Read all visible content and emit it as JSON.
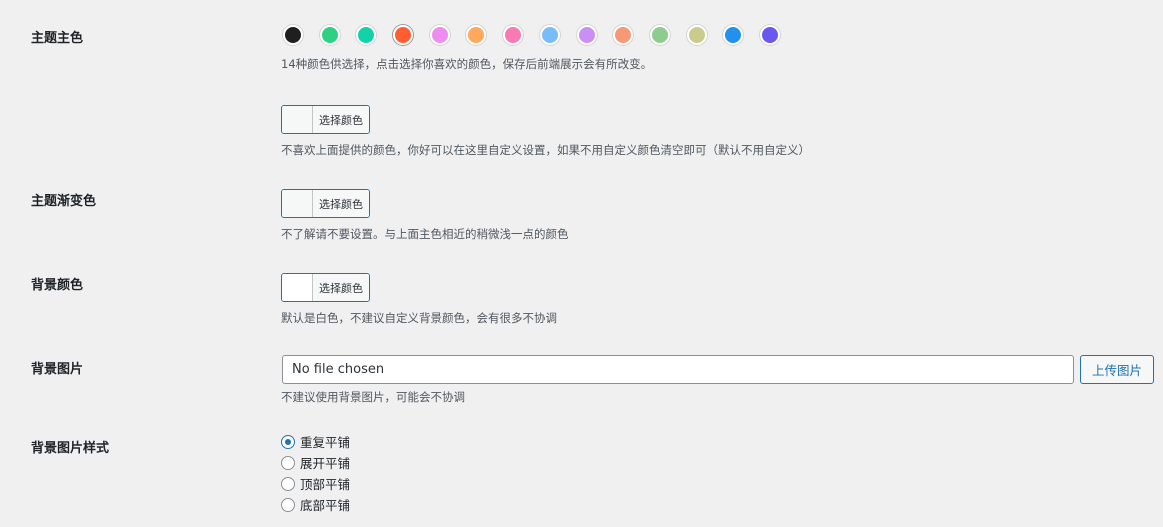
{
  "theme_color": {
    "label": "主题主色",
    "swatches": [
      {
        "name": "black",
        "color": "#1f1f1f"
      },
      {
        "name": "green",
        "color": "#2fd083"
      },
      {
        "name": "teal",
        "color": "#12d2aa"
      },
      {
        "name": "orange-red",
        "color": "#ff5e32",
        "selected": true
      },
      {
        "name": "violet",
        "color": "#ee8cf0"
      },
      {
        "name": "light-orange",
        "color": "#ffa85e"
      },
      {
        "name": "pink",
        "color": "#f97ab2"
      },
      {
        "name": "sky-blue",
        "color": "#78bdfa"
      },
      {
        "name": "lavender",
        "color": "#c98ff5"
      },
      {
        "name": "salmon",
        "color": "#f79876"
      },
      {
        "name": "sage-green",
        "color": "#8dcb8e"
      },
      {
        "name": "khaki",
        "color": "#cccb8e"
      },
      {
        "name": "blue",
        "color": "#2290ec"
      },
      {
        "name": "indigo",
        "color": "#6a57ee"
      }
    ],
    "desc": "14种颜色供选择，点击选择你喜欢的颜色，保存后前端展示会有所改变。"
  },
  "custom_color": {
    "button": "选择颜色",
    "desc": "不喜欢上面提供的颜色，你好可以在这里自定义设置，如果不用自定义颜色清空即可（默认不用自定义）"
  },
  "gradient_color": {
    "label": "主题渐变色",
    "button": "选择颜色",
    "desc": "不了解请不要设置。与上面主色相近的稍微浅一点的颜色"
  },
  "bg_color": {
    "label": "背景颜色",
    "button": "选择颜色",
    "desc": "默认是白色，不建议自定义背景颜色，会有很多不协调"
  },
  "bg_image": {
    "label": "背景图片",
    "file_value": "No file chosen",
    "upload_button": "上传图片",
    "desc": "不建议使用背景图片，可能会不协调"
  },
  "bg_image_style": {
    "label": "背景图片样式",
    "options": [
      {
        "label": "重复平铺",
        "checked": true
      },
      {
        "label": "展开平铺",
        "checked": false
      },
      {
        "label": "顶部平铺",
        "checked": false
      },
      {
        "label": "底部平铺",
        "checked": false
      }
    ]
  }
}
